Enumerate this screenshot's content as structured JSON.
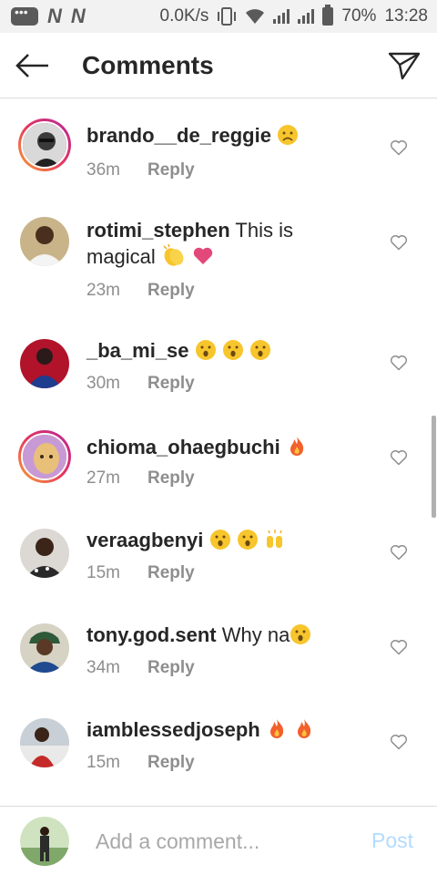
{
  "status_bar": {
    "net_speed": "0.0K/s",
    "battery": "70%",
    "time": "13:28",
    "icons": [
      "message-icon",
      "n-icon",
      "n-icon",
      "vibrate-icon",
      "wifi-icon",
      "signal-icon",
      "signal-icon",
      "battery-icon"
    ]
  },
  "header": {
    "title": "Comments",
    "back_icon": "back-arrow-icon",
    "share_icon": "send-icon"
  },
  "comments": [
    {
      "user": "brando__de_reggie",
      "text": "",
      "emoji": [
        "frown"
      ],
      "time": "36m",
      "reply": "Reply",
      "story_ring": true
    },
    {
      "user": "rotimi_stephen",
      "text": "This is magical",
      "emoji": [
        "clap",
        "heart"
      ],
      "time": "23m",
      "reply": "Reply",
      "story_ring": false
    },
    {
      "user": "_ba_mi_se",
      "text": "",
      "emoji": [
        "wow",
        "wow",
        "wow"
      ],
      "time": "30m",
      "reply": "Reply",
      "story_ring": false
    },
    {
      "user": "chioma_ohaegbuchi",
      "text": "",
      "emoji": [
        "fire"
      ],
      "time": "27m",
      "reply": "Reply",
      "story_ring": true
    },
    {
      "user": "veraagbenyi",
      "text": "",
      "emoji": [
        "wow",
        "wow",
        "raise"
      ],
      "time": "15m",
      "reply": "Reply",
      "story_ring": false
    },
    {
      "user": "tony.god.sent",
      "text": "Why na",
      "emoji": [
        "wow"
      ],
      "time": "34m",
      "reply": "Reply",
      "story_ring": false
    },
    {
      "user": "iamblessedjoseph",
      "text": "",
      "emoji": [
        "fire",
        "fire"
      ],
      "time": "15m",
      "reply": "Reply",
      "story_ring": false
    }
  ],
  "composer": {
    "placeholder": "Add a comment...",
    "value": "",
    "post_label": "Post"
  },
  "colors": {
    "text": "#262626",
    "meta": "#8e8e8e",
    "post_disabled": "#b3dbff",
    "divider": "#dbdbdb"
  }
}
